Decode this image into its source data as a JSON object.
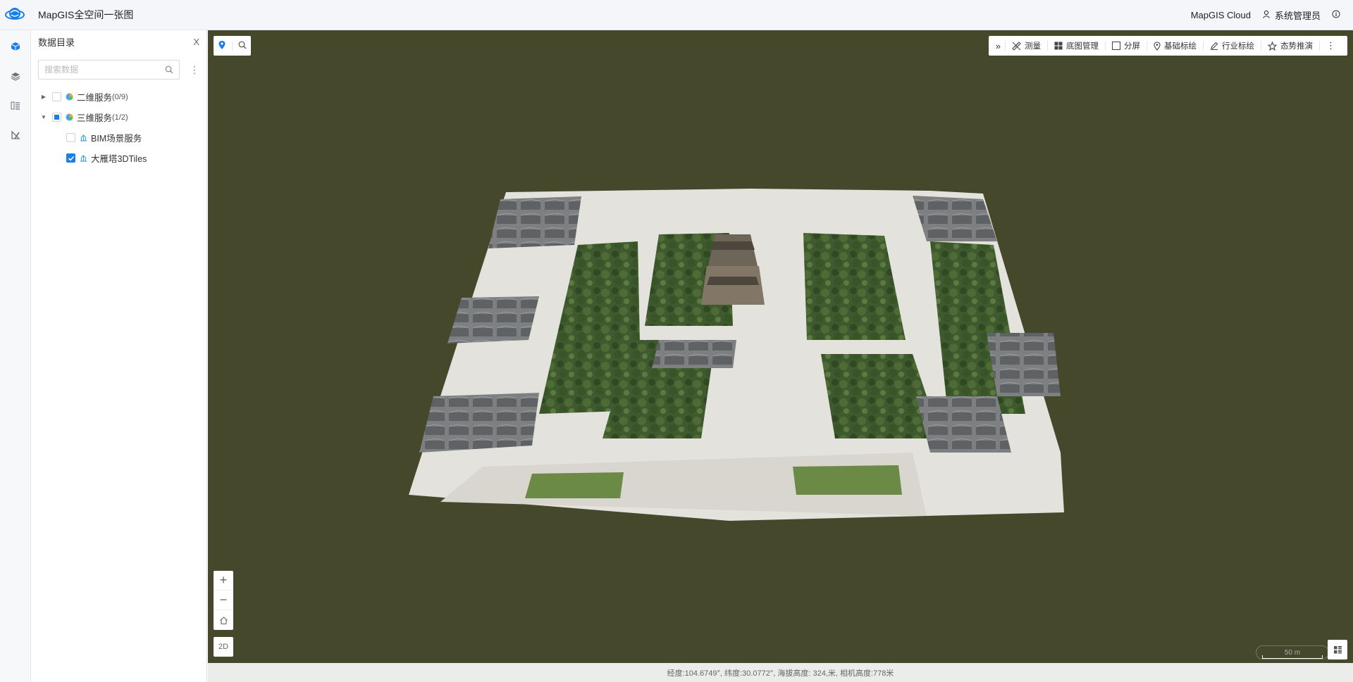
{
  "app": {
    "title": "MapGIS全空间一张图"
  },
  "header": {
    "cloud_label": "MapGIS Cloud",
    "user_name": "系统管理员"
  },
  "panel": {
    "title": "数据目录",
    "close_label": "X",
    "search_placeholder": "搜索数据",
    "tree": [
      {
        "label": "二维服务",
        "count": "(0/9)",
        "expanded": false,
        "state": "unchecked"
      },
      {
        "label": "三维服务",
        "count": "(1/2)",
        "expanded": true,
        "state": "indeterminate",
        "children": [
          {
            "label": "BIM场景服务",
            "state": "unchecked"
          },
          {
            "label": "大雁塔3DTiles",
            "state": "checked"
          }
        ]
      }
    ]
  },
  "toolbar": {
    "expand_label": "»",
    "items": [
      "测量",
      "底图管理",
      "分屏",
      "基础标绘",
      "行业标绘",
      "态势推演"
    ]
  },
  "map": {
    "btn_2d_label": "2D",
    "scale_label": "50 m"
  },
  "status": {
    "text": "经度:104.6749°, 纬度:30.0772°, 海拔高度: 324,米, 相机高度:778米"
  },
  "colors": {
    "accent": "#1a7fe8",
    "map_background": "#46482c"
  }
}
